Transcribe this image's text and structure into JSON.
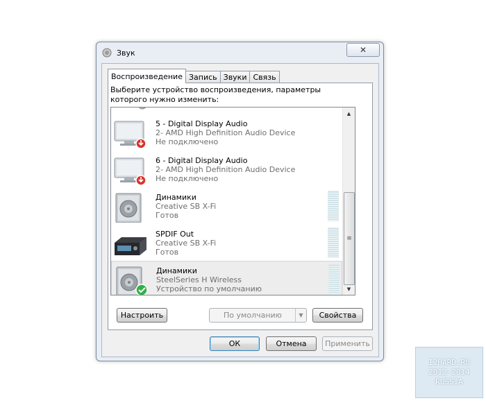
{
  "window": {
    "title": "Звук",
    "close_glyph": "✕"
  },
  "tabs": [
    {
      "label": "Воспроизведение",
      "active": true
    },
    {
      "label": "Запись",
      "active": false
    },
    {
      "label": "Звуки",
      "active": false
    },
    {
      "label": "Связь",
      "active": false
    }
  ],
  "instruction": "Выберите устройство воспроизведения, параметры которого нужно изменить:",
  "devices": [
    {
      "name": "5 - Digital Display Audio",
      "driver": "2- AMD High Definition Audio Device",
      "status": "Не подключено",
      "icon": "monitor-icon",
      "badge": "disconnected-icon"
    },
    {
      "name": "6 - Digital Display Audio",
      "driver": "2- AMD High Definition Audio Device",
      "status": "Не подключено",
      "icon": "monitor-icon",
      "badge": "disconnected-icon"
    },
    {
      "name": "Динамики",
      "driver": "Creative SB X-Fi",
      "status": "Готов",
      "icon": "speaker-icon",
      "badge": ""
    },
    {
      "name": "SPDIF Out",
      "driver": "Creative SB X-Fi",
      "status": "Готов",
      "icon": "spdif-device-icon",
      "badge": ""
    },
    {
      "name": "Динамики",
      "driver": "SteelSeries H Wireless",
      "status": "Устройство по умолчанию",
      "icon": "speaker-icon",
      "badge": "default-check-icon"
    }
  ],
  "buttons": {
    "configure": "Настроить",
    "set_default": "По умолчанию",
    "properties": "Свойства",
    "ok": "ОК",
    "cancel": "Отмена",
    "apply": "Применить"
  },
  "watermark": {
    "line1": "I2HARD.RU",
    "line2": "2012-2014",
    "line3": "RUSSIA"
  },
  "colors": {
    "window_frame": "#e9eef5",
    "disconnected_badge": "#d9342b",
    "default_badge": "#2fb144"
  }
}
